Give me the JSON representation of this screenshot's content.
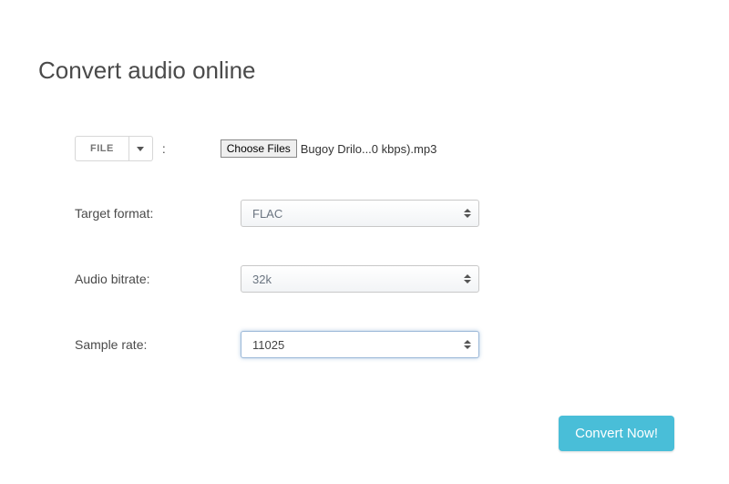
{
  "title": "Convert audio online",
  "file": {
    "button_label": "FILE",
    "colon": ":",
    "choose_button": "Choose Files",
    "chosen_name": "Bugoy Drilo...0 kbps).mp3"
  },
  "fields": {
    "target_format": {
      "label": "Target format:",
      "value": "FLAC"
    },
    "audio_bitrate": {
      "label": "Audio bitrate:",
      "value": "32k"
    },
    "sample_rate": {
      "label": "Sample rate:",
      "value": "11025"
    }
  },
  "convert_button": "Convert Now!"
}
